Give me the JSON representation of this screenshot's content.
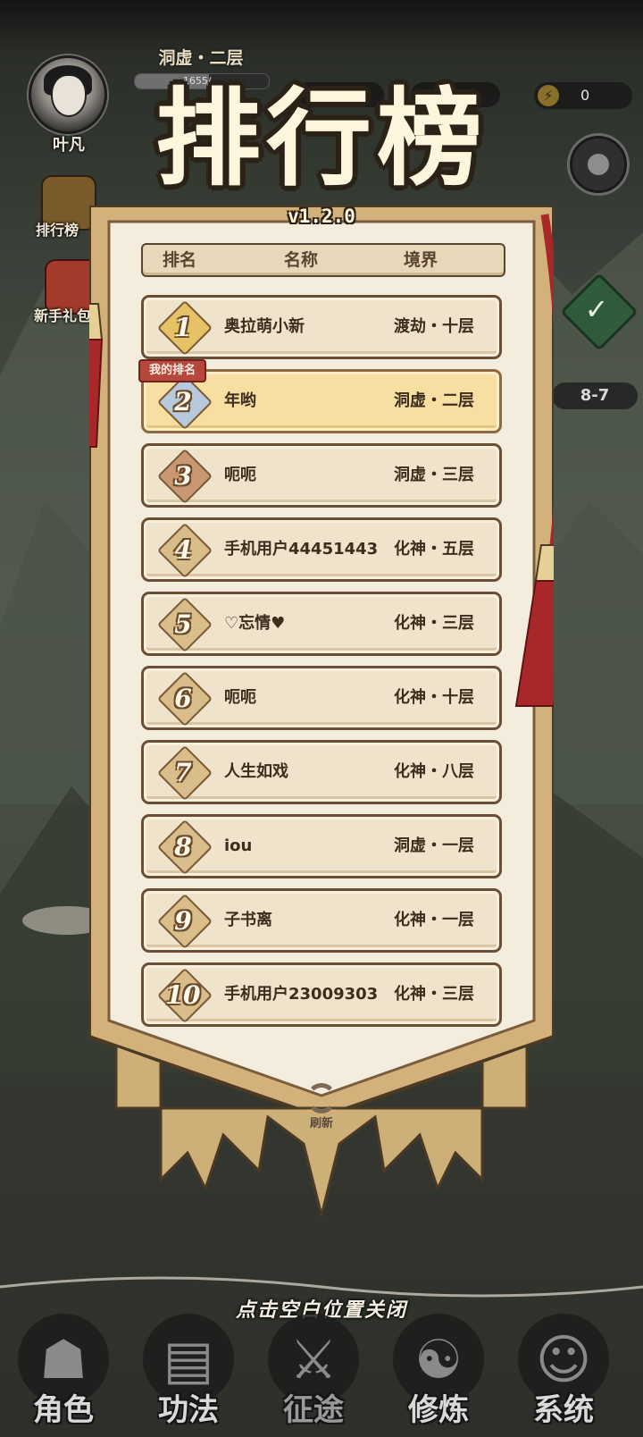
{
  "player": {
    "name": "叶凡",
    "realm": "洞虚・二层",
    "exp_text": "1655/...",
    "exp_fraction": 0.55
  },
  "resources": {
    "energy": "0",
    "stage": "8-7"
  },
  "side": {
    "ranking_label": "排行榜",
    "newbie_label": "新手礼包"
  },
  "panel": {
    "title": "排行榜",
    "version": "v1.2.0",
    "columns": [
      "排名",
      "名称",
      "境界"
    ],
    "my_rank_tag": "我的排名",
    "refresh_label": "刷新",
    "rows": [
      {
        "rank": "1",
        "name": "奥拉萌小新",
        "realm": "渡劫・十层"
      },
      {
        "rank": "2",
        "name": "年哟",
        "realm": "洞虚・二层"
      },
      {
        "rank": "3",
        "name": "呃呃",
        "realm": "洞虚・三层"
      },
      {
        "rank": "4",
        "name": "手机用户44451443",
        "realm": "化神・五层"
      },
      {
        "rank": "5",
        "name": "♡忘情♥",
        "realm": "化神・三层"
      },
      {
        "rank": "6",
        "name": "呃呃",
        "realm": "化神・十层"
      },
      {
        "rank": "7",
        "name": "人生如戏",
        "realm": "化神・八层"
      },
      {
        "rank": "8",
        "name": "iou",
        "realm": "洞虚・一层"
      },
      {
        "rank": "9",
        "name": "子书离",
        "realm": "化神・一层"
      },
      {
        "rank": "10",
        "name": "手机用户23009303",
        "realm": "化神・三层"
      }
    ]
  },
  "close_hint": "点击空白位置关闭",
  "nav": [
    {
      "label": "角色",
      "icon": "character-icon"
    },
    {
      "label": "功法",
      "icon": "scroll-book-icon"
    },
    {
      "label": "征途",
      "icon": "sword-icon"
    },
    {
      "label": "修炼",
      "icon": "meditation-icon"
    },
    {
      "label": "系统",
      "icon": "system-girl-icon"
    }
  ],
  "colors": {
    "banner_cream": "#efe3cb",
    "my_row": "#f6dfa0",
    "tassel_red": "#a8282a",
    "gold": "#d8b77a"
  }
}
